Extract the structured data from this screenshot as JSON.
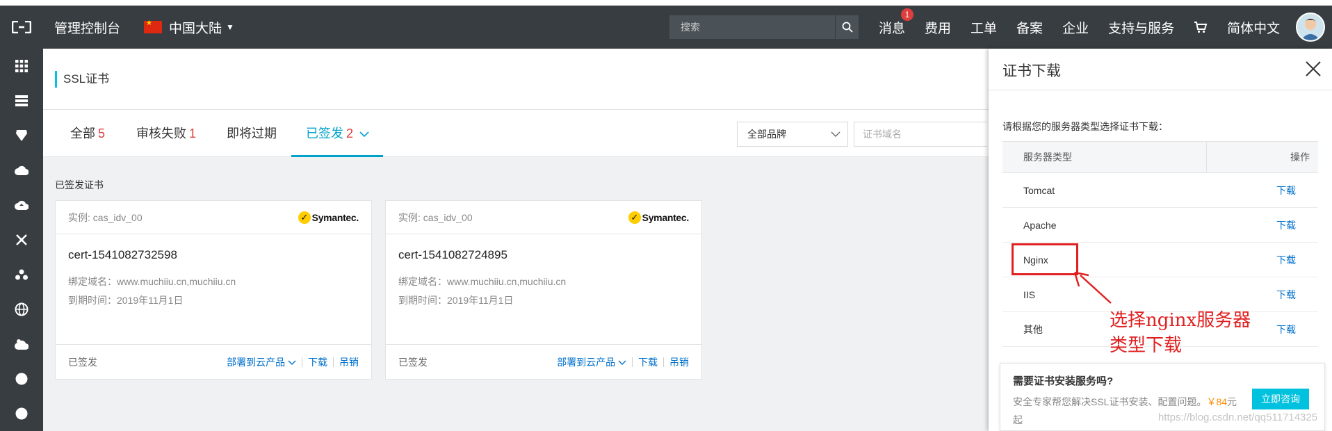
{
  "topbar": {
    "console_label": "管理控制台",
    "region_label": "中国大陆",
    "search_placeholder": "搜索",
    "nav": [
      {
        "label": "消息",
        "badge": "1"
      },
      {
        "label": "费用"
      },
      {
        "label": "工单"
      },
      {
        "label": "备案"
      },
      {
        "label": "企业"
      },
      {
        "label": "支持与服务"
      },
      {
        "label": "简体中文"
      }
    ]
  },
  "breadcrumb": "SSL证书",
  "tabs": [
    {
      "label": "全部",
      "count": "5"
    },
    {
      "label": "审核失败",
      "count": "1"
    },
    {
      "label": "即将过期",
      "count": ""
    },
    {
      "label": "已签发",
      "count": "2"
    }
  ],
  "filters": {
    "brand_value": "全部品牌",
    "domain_placeholder": "证书域名"
  },
  "section_title": "已签发证书",
  "cards": [
    {
      "instance": "实例: cas_idv_00",
      "issuer": "Symantec.",
      "name": "cert-1541082732598",
      "domain": "绑定域名：www.muchiiu.cn,muchiiu.cn",
      "expiry": "到期时间：2019年11月1日",
      "status": "已签发",
      "deploy_label": "部署到云产品",
      "download_label": "下载",
      "revoke_label": "吊销"
    },
    {
      "instance": "实例: cas_idv_00",
      "issuer": "Symantec.",
      "name": "cert-1541082724895",
      "domain": "绑定域名：www.muchiiu.cn,muchiiu.cn",
      "expiry": "到期时间：2019年11月1日",
      "status": "已签发",
      "deploy_label": "部署到云产品",
      "download_label": "下载",
      "revoke_label": "吊销"
    }
  ],
  "panel": {
    "title": "证书下载",
    "hint": "请根据您的服务器类型选择证书下载：",
    "col_type": "服务器类型",
    "col_action": "操作",
    "rows": [
      {
        "type": "Tomcat",
        "action": "下载"
      },
      {
        "type": "Apache",
        "action": "下载"
      },
      {
        "type": "Nginx",
        "action": "下载"
      },
      {
        "type": "IIS",
        "action": "下载"
      },
      {
        "type": "其他",
        "action": "下载"
      }
    ],
    "annotation": "选择nginx服务器类型下载"
  },
  "promo": {
    "title": "需要证书安装服务吗?",
    "desc": "安全专家帮您解决SSL证书安装、配置问题。",
    "price": "￥84",
    "desc_suffix": "元起",
    "button": "立即咨询"
  },
  "watermark": "https://blog.csdn.net/qq511714325",
  "colors": {
    "topbar": "#373d41",
    "accent": "#00c1de",
    "active_tab": "#00a2ca",
    "link": "#0070cc",
    "count": "#e03e3e",
    "annotation": "#e02020"
  }
}
